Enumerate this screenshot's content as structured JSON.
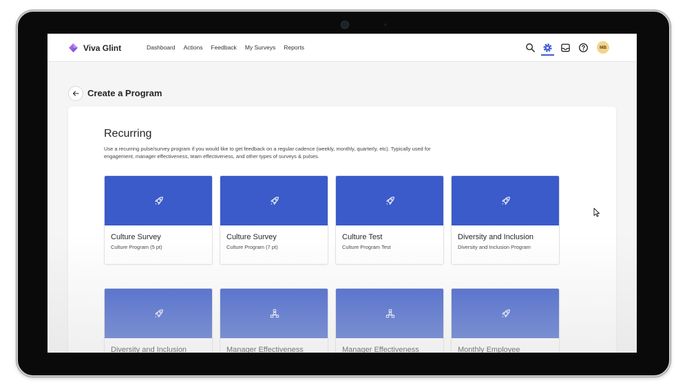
{
  "app": {
    "name": "Viva Glint"
  },
  "nav": {
    "items": [
      "Dashboard",
      "Actions",
      "Feedback",
      "My Surveys",
      "Reports"
    ]
  },
  "toolbar": {
    "icons": [
      "search-icon",
      "gear-icon",
      "inbox-icon",
      "help-icon"
    ],
    "avatar_initials": "MB",
    "accent_color": "#3b5bd0"
  },
  "page": {
    "title": "Create a Program"
  },
  "section": {
    "title": "Recurring",
    "description": "Use a recurring pulse/survey program if you would like to get feedback on a regular cadence (weekly, monthly, quarterly, etc). Typically used for engagement, manager effectiveness, team effectiveness, and other types of surveys & pulses."
  },
  "cards": [
    {
      "title": "Culture Survey",
      "subtitle": "Culture Program (5 pt)",
      "icon": "rocket-icon"
    },
    {
      "title": "Culture Survey",
      "subtitle": "Culture Program (7 pt)",
      "icon": "rocket-icon"
    },
    {
      "title": "Culture Test",
      "subtitle": "Culture Program Test",
      "icon": "rocket-icon"
    },
    {
      "title": "Diversity and Inclusion",
      "subtitle": "Diversity and Inclusion Program",
      "icon": "rocket-icon"
    },
    {
      "title": "Diversity and Inclusion",
      "subtitle": "",
      "icon": "rocket-icon"
    },
    {
      "title": "Manager Effectiveness",
      "subtitle": "",
      "icon": "org-chart-icon"
    },
    {
      "title": "Manager Effectiveness",
      "subtitle": "",
      "icon": "org-chart-icon"
    },
    {
      "title": "Monthly Employee",
      "subtitle": "",
      "icon": "rocket-icon"
    }
  ],
  "colors": {
    "banner": "#3a5bc9",
    "avatar_bg": "#f3d38e"
  }
}
